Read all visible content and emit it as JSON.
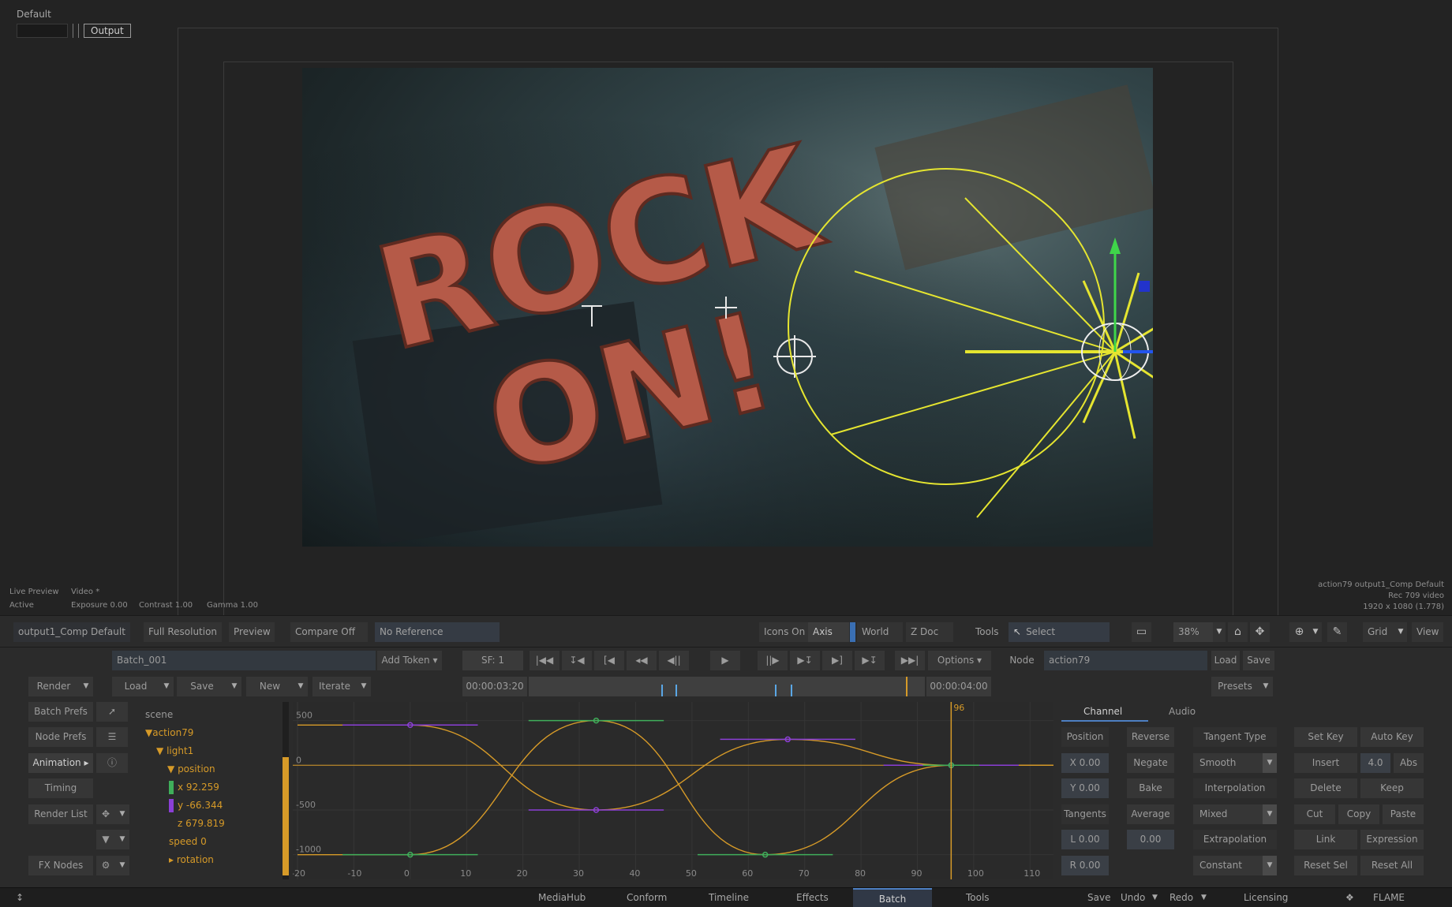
{
  "viewport": {
    "title": "Default",
    "output_tab": "Output",
    "info_left": {
      "live_preview": "Live Preview",
      "video": "Video *",
      "active": "Active",
      "exposure": "Exposure 0.00",
      "contrast": "Contrast 1.00",
      "gamma": "Gamma 1.00"
    },
    "info_right": {
      "line1": "action79 output1_Comp Default",
      "line2": "Rec 709 video",
      "line3": "1920 x 1080 (1.778)"
    },
    "image_text": "ROCK ON!"
  },
  "toolbar": {
    "view_name": "output1_Comp Default",
    "full_resolution": "Full Resolution",
    "preview": "Preview",
    "compare": "Compare Off",
    "reference": "No Reference",
    "icons_on": "Icons On",
    "axis": "Axis",
    "world": "World",
    "z_doc": "Z Doc",
    "tools": "Tools",
    "select": "Select",
    "zoom": "38%",
    "grid": "Grid",
    "view": "View"
  },
  "panel": {
    "batch_name": "Batch_001",
    "add_token": "Add Token",
    "frame_counter": "SF: 1",
    "options": "Options",
    "node_label": "Node",
    "node_value": "action79",
    "load": "Load",
    "save": "Save",
    "presets": "Presets",
    "render": "Render",
    "load_menu": "Load",
    "save_menu": "Save",
    "new": "New",
    "iterate": "Iterate",
    "timecode_in": "00:00:03:20",
    "timecode_out": "00:00:04:00",
    "left_buttons": [
      "Batch Prefs",
      "Node Prefs",
      "Animation",
      "Timing",
      "Render List",
      "FX Nodes"
    ],
    "tree": {
      "scene": "scene",
      "action": "action79",
      "light": "light1",
      "position": "position",
      "x": "x 92.259",
      "y": "y -66.344",
      "z": "z 679.819",
      "speed": "speed 0",
      "rotation": "rotation"
    },
    "graph": {
      "y_ticks": [
        "500",
        "0",
        "-500",
        "-1000"
      ],
      "x_ticks": [
        "-20",
        "-10",
        "0",
        "10",
        "20",
        "30",
        "40",
        "50",
        "60",
        "70",
        "80",
        "90",
        "100",
        "110"
      ],
      "current_frame": "96"
    },
    "right": {
      "tab_channel": "Channel",
      "tab_audio": "Audio",
      "position_label": "Position",
      "x_value": "X 0.00",
      "y_value": "Y 0.00",
      "tangents_label": "Tangents",
      "l_value": "L 0.00",
      "r_value": "R 0.00",
      "reverse": "Reverse",
      "negate": "Negate",
      "bake": "Bake",
      "average": "Average",
      "average_value": "0.00",
      "tangent_type_label": "Tangent Type",
      "tangent_type": "Smooth",
      "interpolation_label": "Interpolation",
      "interpolation": "Mixed",
      "extrapolation_label": "Extrapolation",
      "extrapolation": "Constant",
      "set_key": "Set Key",
      "auto_key": "Auto Key",
      "insert": "Insert",
      "insert_value": "4.0",
      "abs": "Abs",
      "delete": "Delete",
      "keep": "Keep",
      "cut": "Cut",
      "copy": "Copy",
      "paste": "Paste",
      "link": "Link",
      "expression": "Expression",
      "reset_sel": "Reset Sel",
      "reset_all": "Reset All"
    }
  },
  "statusbar": {
    "tabs": [
      "MediaHub",
      "Conform",
      "Timeline",
      "Effects",
      "Batch",
      "Tools"
    ],
    "active_tab": "Batch",
    "save": "Save",
    "undo": "Undo",
    "redo": "Redo",
    "licensing": "Licensing",
    "brand": "FLAME"
  },
  "colors": {
    "accent_orange": "#d69a28",
    "accent_blue": "#4d7fc2",
    "curve_green": "#3fae5a",
    "curve_purple": "#8b3fd6"
  }
}
